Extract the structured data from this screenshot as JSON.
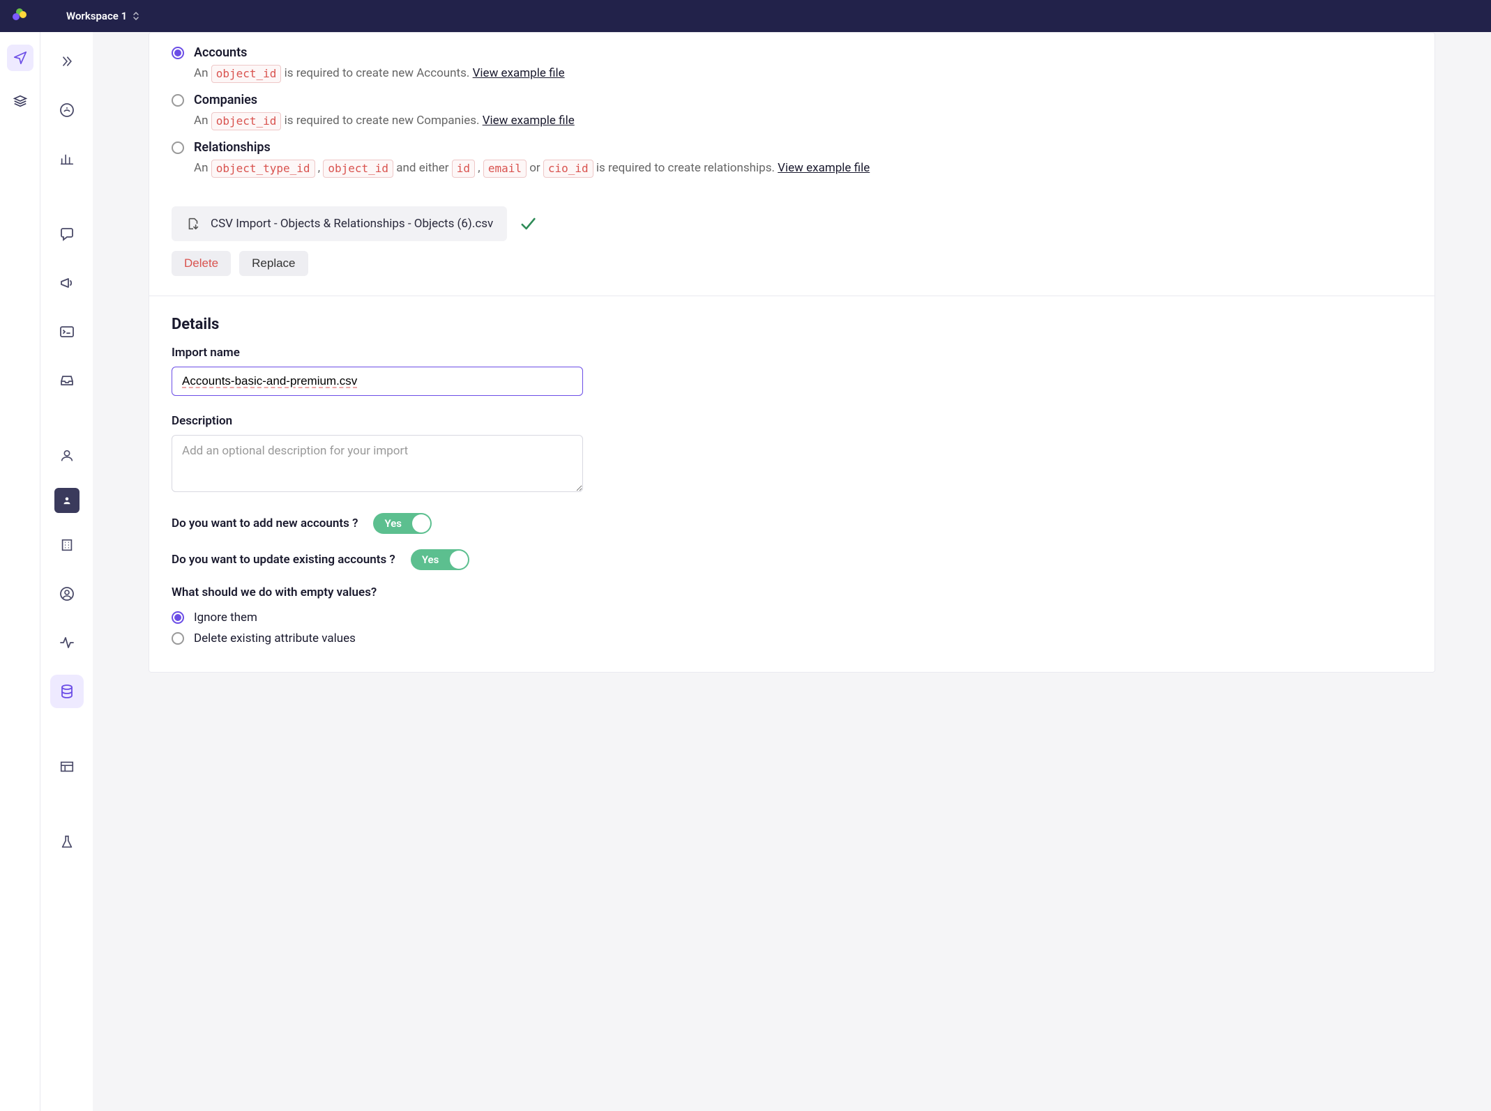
{
  "topbar": {
    "workspace": "Workspace 1"
  },
  "import_types": {
    "accounts": {
      "label": "Accounts",
      "desc_prefix": "An ",
      "code1": "object_id",
      "desc_mid": " is required to create new Accounts. ",
      "link": "View example file"
    },
    "companies": {
      "label": "Companies",
      "desc_prefix": "An ",
      "code1": "object_id",
      "desc_mid": " is required to create new Companies. ",
      "link": "View example file"
    },
    "relationships": {
      "label": "Relationships",
      "desc_prefix": "An ",
      "code1": "object_type_id",
      "sep1": " , ",
      "code2": "object_id",
      "mid1": " and either ",
      "code3": "id",
      "sep2": " , ",
      "code4": "email",
      "mid2": " or ",
      "code5": "cio_id",
      "mid3": " is required to create relationships. ",
      "link": "View example file"
    }
  },
  "file": {
    "name": "CSV Import - Objects & Relationships - Objects (6).csv",
    "delete_label": "Delete",
    "replace_label": "Replace"
  },
  "details": {
    "section_title": "Details",
    "import_name_label": "Import name",
    "import_name_value": "Accounts-basic-and-premium.csv",
    "description_label": "Description",
    "description_placeholder": "Add an optional description for your import",
    "q_add": "Do you want to add new accounts ?",
    "q_update": "Do you want to update existing accounts ?",
    "toggle_yes": "Yes",
    "q_empty": "What should we do with empty values?",
    "opt_ignore": "Ignore them",
    "opt_delete": "Delete existing attribute values"
  }
}
